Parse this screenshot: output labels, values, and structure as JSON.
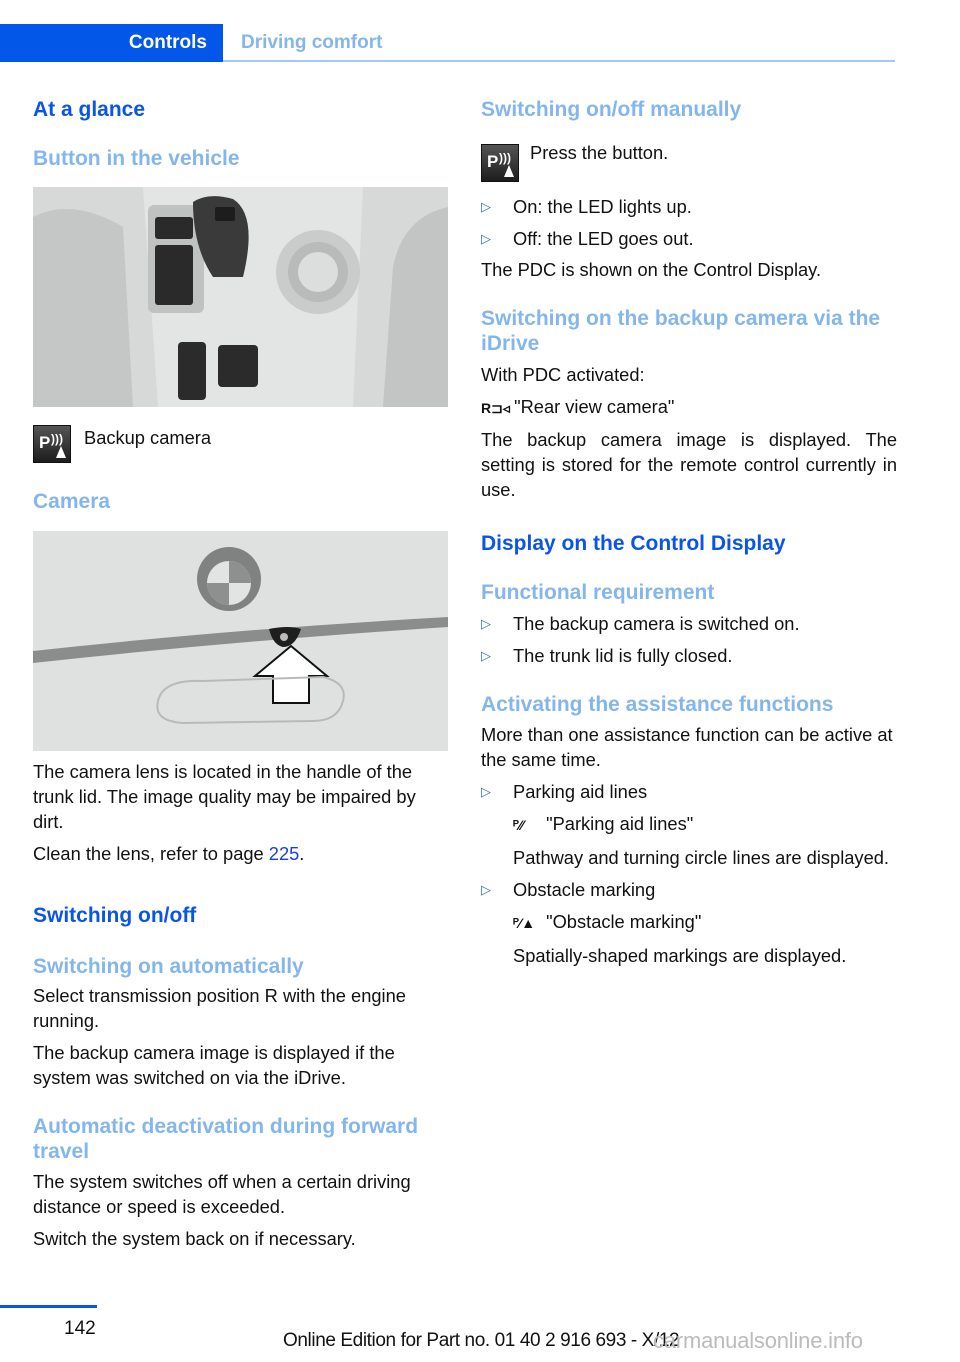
{
  "header": {
    "tab_active": "Controls",
    "tab_inactive": "Driving comfort"
  },
  "left": {
    "h_at_a_glance": "At a glance",
    "h_button": "Button in the vehicle",
    "button_caption": "Backup camera",
    "h_camera": "Camera",
    "camera_text": "The camera lens is located in the handle of the trunk lid. The image quality may be impaired by dirt.",
    "clean_text_pre": "Clean the lens, refer to page ",
    "clean_page": "225",
    "clean_text_post": ".",
    "h_switching": "Switching on/off",
    "h_auto": "Switching on automatically",
    "auto_text1": "Select transmission position R with the engine running.",
    "auto_text2": "The backup camera image is displayed if the system was switched on via the iDrive.",
    "h_deact": "Automatic deactivation during forward travel",
    "deact_text1": "The system switches off when a certain driving distance or speed is exceeded.",
    "deact_text2": "Switch the system back on if necessary."
  },
  "right": {
    "h_manual": "Switching on/off manually",
    "press_text": "Press the button.",
    "manual_bullets": [
      "On: the LED lights up.",
      "Off: the LED goes out."
    ],
    "pdc_text": "The PDC is shown on the Control Display.",
    "h_idrive": "Switching on the backup camera via the iDrive",
    "with_pdc": "With PDC activated:",
    "rear_view_label": "\"Rear view camera\"",
    "idrive_text": "The backup camera image is displayed. The setting is stored for the remote control currently in use.",
    "h_display": "Display on the Control Display",
    "h_func": "Functional requirement",
    "func_bullets": [
      "The backup camera is switched on.",
      "The trunk lid is fully closed."
    ],
    "h_assist": "Activating the assistance functions",
    "assist_text": "More than one assistance function can be active at the same time.",
    "assist_items": [
      {
        "title": "Parking aid lines",
        "menu": "\"Parking aid lines\"",
        "desc": "Pathway and turning circle lines are displayed."
      },
      {
        "title": "Obstacle marking",
        "menu": "\"Obstacle marking\"",
        "desc": "Spatially-shaped markings are displayed."
      }
    ]
  },
  "footer": {
    "page_number": "142",
    "edition": "Online Edition for Part no. 01 40 2 916 693 - X/12",
    "watermark": "carmanualsonline.info"
  },
  "bullet_glyph": "▷",
  "icons": {
    "pdc_button": "pdc-button-icon",
    "rear_view": "rear-view-camera-icon",
    "parking_lines": "parking-aid-lines-icon",
    "obstacle": "obstacle-marking-icon"
  }
}
